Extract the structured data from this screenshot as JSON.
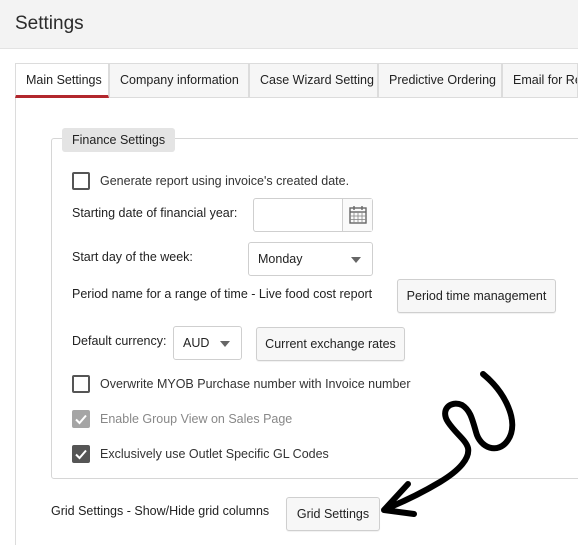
{
  "header": {
    "title": "Settings"
  },
  "tabs": [
    {
      "label": "Main Settings",
      "active": true
    },
    {
      "label": "Company information",
      "active": false
    },
    {
      "label": "Case Wizard Setting",
      "active": false
    },
    {
      "label": "Predictive Ordering",
      "active": false
    },
    {
      "label": "Email for Re",
      "active": false
    }
  ],
  "finance": {
    "legend": "Finance Settings",
    "generate_report": {
      "label": "Generate report using invoice's created date.",
      "checked": false
    },
    "start_date": {
      "label": "Starting date of financial year:",
      "value": "",
      "icon": "calendar-icon"
    },
    "start_day": {
      "label": "Start day of the week:",
      "selected": "Monday"
    },
    "period": {
      "label": "Period name for a range of time - Live food cost report",
      "button": "Period time management"
    },
    "currency": {
      "label": "Default currency:",
      "selected": "AUD",
      "button": "Current exchange rates"
    },
    "overwrite_myob": {
      "label": "Overwrite MYOB Purchase number with Invoice number",
      "checked": false
    },
    "group_view": {
      "label": "Enable Group View on Sales Page",
      "checked": true,
      "disabled": true
    },
    "outlet_gl": {
      "label": "Exclusively use Outlet Specific GL Codes",
      "checked": true
    }
  },
  "grid": {
    "label": "Grid Settings - Show/Hide grid columns",
    "button": "Grid Settings"
  },
  "colors": {
    "accent": "#b2272d",
    "annotation": "#000000"
  }
}
